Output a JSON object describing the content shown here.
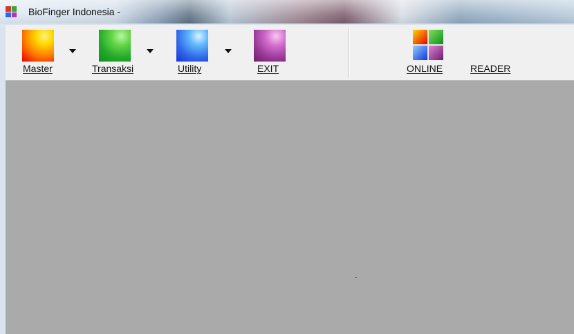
{
  "window": {
    "title": "BioFinger Indonesia -"
  },
  "toolbar": {
    "master": {
      "label": "Master",
      "color_top": "#ffd800",
      "color_bottom": "#e60000"
    },
    "transaksi": {
      "label": "Transaksi",
      "color_top": "#7ee05a",
      "color_bottom": "#0f8f1f"
    },
    "utility": {
      "label": "Utility",
      "color_top": "#8ed0ff",
      "color_bottom": "#1535d8"
    },
    "exit": {
      "label": "EXIT",
      "color_top": "#e07fd8",
      "color_bottom": "#6a1f6a"
    },
    "online": {
      "label": "ONLINE",
      "icon_name": "online-quad-icon"
    },
    "reader": {
      "label": "READER"
    }
  }
}
